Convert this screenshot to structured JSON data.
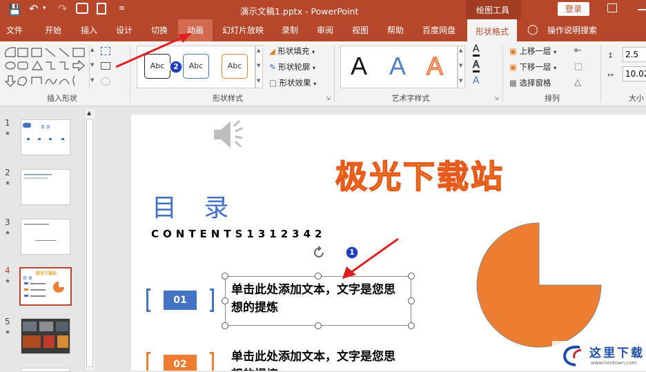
{
  "titlebar": {
    "doc_title": "演示文稿1.pptx - PowerPoint",
    "context_tool": "绘图工具",
    "login_label": "登录"
  },
  "tabs": [
    {
      "label": "文件"
    },
    {
      "label": "开始"
    },
    {
      "label": "插入"
    },
    {
      "label": "设计"
    },
    {
      "label": "切换"
    },
    {
      "label": "动画"
    },
    {
      "label": "幻灯片放映"
    },
    {
      "label": "录制"
    },
    {
      "label": "审阅"
    },
    {
      "label": "视图"
    },
    {
      "label": "帮助"
    },
    {
      "label": "百度网盘"
    },
    {
      "label": "形状格式"
    }
  ],
  "tell_me": "操作说明搜索",
  "ribbon": {
    "insert_shapes_label": "插入形状",
    "shape_styles_label": "形状样式",
    "style_preset": "Abc",
    "fill_label": "形状填充",
    "outline_label": "形状轮廓",
    "effects_label": "形状效果",
    "wordart_label": "艺术字样式",
    "wordart_glyph": "A",
    "arrange_label": "排列",
    "bring_forward": "上移一层",
    "send_backward": "下移一层",
    "selection_pane": "选择窗格",
    "size_label": "大小",
    "height_value": "2.5",
    "width_value": "10.02"
  },
  "thumbnails": [
    {
      "num": "1",
      "star": "★"
    },
    {
      "num": "2",
      "star": "★"
    },
    {
      "num": "3",
      "star": "★"
    },
    {
      "num": "4",
      "star": "★"
    },
    {
      "num": "5",
      "star": "★"
    }
  ],
  "thumb_text": {
    "t1_title": "目 录",
    "t4_title": "极光下载站",
    "t4_toc": "目 录"
  },
  "slide": {
    "wordart_title": "极光下载站",
    "toc_title": "目 录",
    "contents": "CONTENTS1312342",
    "item1_num": "01",
    "item1_text": "单击此处添加文本，文字是您思想的提炼",
    "item2_num": "02",
    "item2_text": "单击此处添加文本，文字是您思想的提炼"
  },
  "badges": {
    "b1": "1",
    "b2": "2"
  },
  "watermark": {
    "text": "这里下载",
    "url": "www.herdown.com"
  },
  "colors": {
    "accent": "#b7472a",
    "blue": "#4472c4",
    "orange": "#ed7d31",
    "annot_red": "#e02020",
    "annot_blue": "#1f3fbf"
  }
}
